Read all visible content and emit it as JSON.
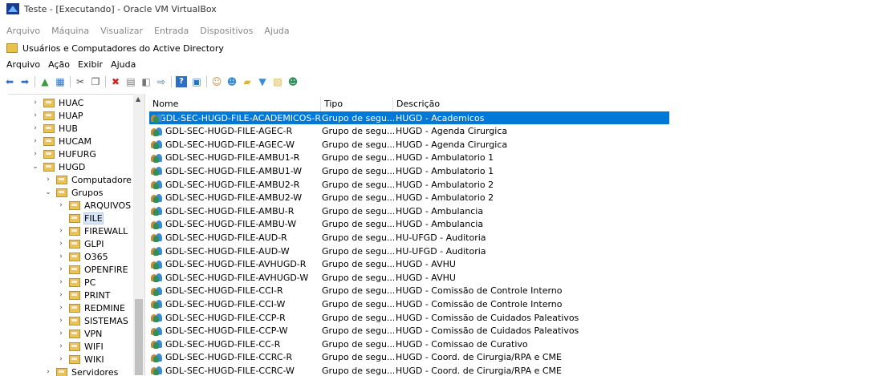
{
  "vbox": {
    "title": "Teste - [Executando] - Oracle VM VirtualBox",
    "menu": [
      "Arquivo",
      "Máquina",
      "Visualizar",
      "Entrada",
      "Dispositivos",
      "Ajuda"
    ]
  },
  "mmc": {
    "title": "Usuários e Computadores do Active Directory",
    "menu": [
      "Arquivo",
      "Ação",
      "Exibir",
      "Ajuda"
    ]
  },
  "toolbar": {
    "icons": [
      "back-arrow-icon",
      "forward-arrow-icon",
      "up-folder-icon",
      "show-tree-icon",
      "cut-icon",
      "copy-icon",
      "delete-icon",
      "properties-icon",
      "refresh-icon",
      "export-icon",
      "help-icon",
      "console-icon",
      "add-user-icon",
      "add-group-icon",
      "new-ou-icon",
      "filter-icon",
      "new-object-icon",
      "delegate-icon"
    ]
  },
  "tree": {
    "items": [
      {
        "label": "HUAC",
        "level": 0,
        "expander": "›"
      },
      {
        "label": "HUAP",
        "level": 0,
        "expander": "›"
      },
      {
        "label": "HUB",
        "level": 0,
        "expander": "›"
      },
      {
        "label": "HUCAM",
        "level": 0,
        "expander": "›"
      },
      {
        "label": "HUFURG",
        "level": 0,
        "expander": "›"
      },
      {
        "label": "HUGD",
        "level": 0,
        "expander": "⌄"
      },
      {
        "label": "Computadore",
        "level": 1,
        "expander": "›"
      },
      {
        "label": "Grupos",
        "level": 1,
        "expander": "⌄"
      },
      {
        "label": "ARQUIVOS",
        "level": 2,
        "expander": "›"
      },
      {
        "label": "FILE",
        "level": 2,
        "expander": "",
        "selected": true
      },
      {
        "label": "FIREWALL",
        "level": 2,
        "expander": "›"
      },
      {
        "label": "GLPI",
        "level": 2,
        "expander": "›"
      },
      {
        "label": "O365",
        "level": 2,
        "expander": "›"
      },
      {
        "label": "OPENFIRE",
        "level": 2,
        "expander": "›"
      },
      {
        "label": "PC",
        "level": 2,
        "expander": "›"
      },
      {
        "label": "PRINT",
        "level": 2,
        "expander": "›"
      },
      {
        "label": "REDMINE",
        "level": 2,
        "expander": "›"
      },
      {
        "label": "SISTEMAS",
        "level": 2,
        "expander": "›"
      },
      {
        "label": "VPN",
        "level": 2,
        "expander": "›"
      },
      {
        "label": "WIFI",
        "level": 2,
        "expander": "›"
      },
      {
        "label": "WIKI",
        "level": 2,
        "expander": "›"
      },
      {
        "label": "Servidores",
        "level": 1,
        "expander": "›"
      }
    ]
  },
  "list": {
    "columns": [
      "Nome",
      "Tipo",
      "Descrição"
    ],
    "rows": [
      {
        "name": "GDL-SEC-HUGD-FILE-ACADEMICOS-R",
        "type": "Grupo de segu...",
        "desc": "HUGD - Academicos",
        "selected": true
      },
      {
        "name": "GDL-SEC-HUGD-FILE-AGEC-R",
        "type": "Grupo de segu...",
        "desc": "HUGD - Agenda Cirurgica"
      },
      {
        "name": "GDL-SEC-HUGD-FILE-AGEC-W",
        "type": "Grupo de segu...",
        "desc": "HUGD - Agenda Cirurgica"
      },
      {
        "name": "GDL-SEC-HUGD-FILE-AMBU1-R",
        "type": "Grupo de segu...",
        "desc": "HUGD - Ambulatorio 1"
      },
      {
        "name": "GDL-SEC-HUGD-FILE-AMBU1-W",
        "type": "Grupo de segu...",
        "desc": "HUGD - Ambulatorio 1"
      },
      {
        "name": "GDL-SEC-HUGD-FILE-AMBU2-R",
        "type": "Grupo de segu...",
        "desc": "HUGD - Ambulatorio 2"
      },
      {
        "name": "GDL-SEC-HUGD-FILE-AMBU2-W",
        "type": "Grupo de segu...",
        "desc": "HUGD - Ambulatorio 2"
      },
      {
        "name": "GDL-SEC-HUGD-FILE-AMBU-R",
        "type": "Grupo de segu...",
        "desc": "HUGD - Ambulancia"
      },
      {
        "name": "GDL-SEC-HUGD-FILE-AMBU-W",
        "type": "Grupo de segu...",
        "desc": "HUGD - Ambulancia"
      },
      {
        "name": "GDL-SEC-HUGD-FILE-AUD-R",
        "type": "Grupo de segu...",
        "desc": "HU-UFGD - Auditoria"
      },
      {
        "name": "GDL-SEC-HUGD-FILE-AUD-W",
        "type": "Grupo de segu...",
        "desc": "HU-UFGD - Auditoria"
      },
      {
        "name": "GDL-SEC-HUGD-FILE-AVHUGD-R",
        "type": "Grupo de segu...",
        "desc": "HUGD - AVHU"
      },
      {
        "name": "GDL-SEC-HUGD-FILE-AVHUGD-W",
        "type": "Grupo de segu...",
        "desc": "HUGD - AVHU"
      },
      {
        "name": "GDL-SEC-HUGD-FILE-CCI-R",
        "type": "Grupo de segu...",
        "desc": "HUGD - Comissão de Controle Interno"
      },
      {
        "name": "GDL-SEC-HUGD-FILE-CCI-W",
        "type": "Grupo de segu...",
        "desc": "HUGD - Comissão de Controle Interno"
      },
      {
        "name": "GDL-SEC-HUGD-FILE-CCP-R",
        "type": "Grupo de segu...",
        "desc": "HUGD - Comissão de Cuidados Paleativos"
      },
      {
        "name": "GDL-SEC-HUGD-FILE-CCP-W",
        "type": "Grupo de segu...",
        "desc": "HUGD - Comissão de Cuidados Paleativos"
      },
      {
        "name": "GDL-SEC-HUGD-FILE-CC-R",
        "type": "Grupo de segu...",
        "desc": "HUGD - Comissao de Curativo"
      },
      {
        "name": "GDL-SEC-HUGD-FILE-CCRC-R",
        "type": "Grupo de segu...",
        "desc": "HUGD - Coord. de Cirurgia/RPA e CME"
      },
      {
        "name": "GDL-SEC-HUGD-FILE-CCRC-W",
        "type": "Grupo de segu...",
        "desc": "HUGD - Coord. de Cirurgia/RPA e CME"
      }
    ]
  },
  "colors": {
    "selection": "#0078d7",
    "folder": "#e9c357"
  }
}
